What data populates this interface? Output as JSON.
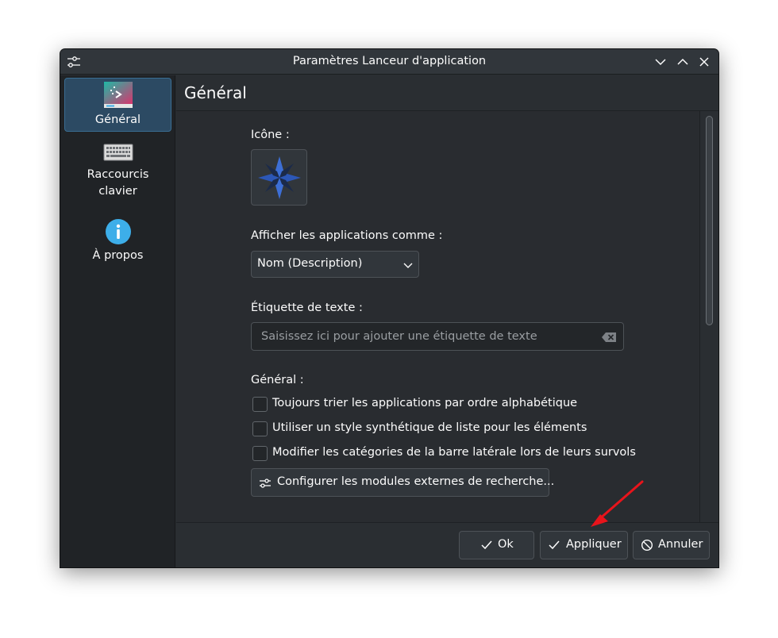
{
  "window": {
    "title": "Paramètres Lanceur d'application",
    "icons": {
      "app": "sliders-icon",
      "minimize": "chevron-down-icon",
      "maximize": "chevron-up-icon",
      "close": "close-icon"
    }
  },
  "sidebar": {
    "items": [
      {
        "label": "Général",
        "icon": "general-settings-icon",
        "selected": true
      },
      {
        "label": "Raccourcis",
        "label2": "clavier",
        "icon": "keyboard-icon",
        "selected": false
      },
      {
        "label": "À propos",
        "icon": "info-icon",
        "selected": false
      }
    ]
  },
  "header": {
    "title": "Général"
  },
  "form": {
    "icon_label": "Icône :",
    "display_label": "Afficher les applications comme :",
    "display_value": "Nom (Description)",
    "text_label_heading": "Étiquette de texte :",
    "text_label_placeholder": "Saisissez ici pour ajouter une étiquette de texte",
    "text_label_value": "",
    "general_heading": "Général :",
    "checkboxes": [
      {
        "label": "Toujours trier les applications par ordre alphabétique",
        "checked": false
      },
      {
        "label": "Utiliser un style synthétique de liste pour les éléments",
        "checked": false
      },
      {
        "label": "Modifier les catégories de la barre latérale lors de leurs survols",
        "checked": false
      }
    ],
    "configure_button": "Configurer les modules externes de recherche..."
  },
  "footer": {
    "ok": "Ok",
    "apply": "Appliquer",
    "cancel": "Annuler"
  },
  "colors": {
    "window_bg": "#2a2e32",
    "sidebar_bg": "#202326",
    "selection": "#2c4a63",
    "accent": "#3daee9",
    "annotation_arrow": "#e8141b"
  }
}
